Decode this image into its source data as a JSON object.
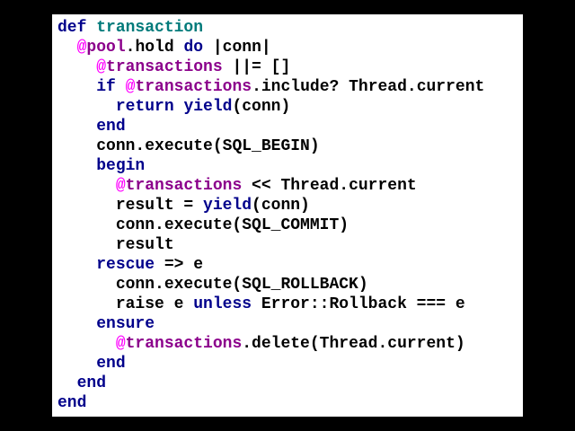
{
  "colors": {
    "background": "#000000",
    "panel": "#ffffff",
    "plain": "#000000",
    "keyword": "#00008b",
    "method_name": "#007a7a",
    "ivar_at": "#ff00ff",
    "ivar_name": "#8b008b"
  },
  "code": {
    "lines": [
      {
        "indent": 0,
        "tokens": [
          {
            "t": "def",
            "k": "keyword"
          },
          {
            "t": " ",
            "k": "plain"
          },
          {
            "t": "transaction",
            "k": "method_name"
          }
        ]
      },
      {
        "indent": 1,
        "tokens": [
          {
            "t": "@",
            "k": "ivar_at"
          },
          {
            "t": "pool",
            "k": "ivar_name"
          },
          {
            "t": ".hold ",
            "k": "plain"
          },
          {
            "t": "do",
            "k": "keyword"
          },
          {
            "t": " |conn|",
            "k": "plain"
          }
        ]
      },
      {
        "indent": 2,
        "tokens": [
          {
            "t": "@",
            "k": "ivar_at"
          },
          {
            "t": "transactions",
            "k": "ivar_name"
          },
          {
            "t": " ||= []",
            "k": "plain"
          }
        ]
      },
      {
        "indent": 2,
        "tokens": [
          {
            "t": "if",
            "k": "keyword"
          },
          {
            "t": " ",
            "k": "plain"
          },
          {
            "t": "@",
            "k": "ivar_at"
          },
          {
            "t": "transactions",
            "k": "ivar_name"
          },
          {
            "t": ".include? Thread.current",
            "k": "plain"
          }
        ]
      },
      {
        "indent": 3,
        "tokens": [
          {
            "t": "return",
            "k": "keyword"
          },
          {
            "t": " ",
            "k": "plain"
          },
          {
            "t": "yield",
            "k": "keyword"
          },
          {
            "t": "(conn)",
            "k": "plain"
          }
        ]
      },
      {
        "indent": 2,
        "tokens": [
          {
            "t": "end",
            "k": "keyword"
          }
        ]
      },
      {
        "indent": 2,
        "tokens": [
          {
            "t": "conn.execute(SQL_BEGIN)",
            "k": "plain"
          }
        ]
      },
      {
        "indent": 2,
        "tokens": [
          {
            "t": "begin",
            "k": "keyword"
          }
        ]
      },
      {
        "indent": 3,
        "tokens": [
          {
            "t": "@",
            "k": "ivar_at"
          },
          {
            "t": "transactions",
            "k": "ivar_name"
          },
          {
            "t": " << Thread.current",
            "k": "plain"
          }
        ]
      },
      {
        "indent": 3,
        "tokens": [
          {
            "t": "result = ",
            "k": "plain"
          },
          {
            "t": "yield",
            "k": "keyword"
          },
          {
            "t": "(conn)",
            "k": "plain"
          }
        ]
      },
      {
        "indent": 3,
        "tokens": [
          {
            "t": "conn.execute(SQL_COMMIT)",
            "k": "plain"
          }
        ]
      },
      {
        "indent": 3,
        "tokens": [
          {
            "t": "result",
            "k": "plain"
          }
        ]
      },
      {
        "indent": 2,
        "tokens": [
          {
            "t": "rescue",
            "k": "keyword"
          },
          {
            "t": " => e",
            "k": "plain"
          }
        ]
      },
      {
        "indent": 3,
        "tokens": [
          {
            "t": "conn.execute(SQL_ROLLBACK)",
            "k": "plain"
          }
        ]
      },
      {
        "indent": 3,
        "tokens": [
          {
            "t": "raise e ",
            "k": "plain"
          },
          {
            "t": "unless",
            "k": "keyword"
          },
          {
            "t": " Error::Rollback === e",
            "k": "plain"
          }
        ]
      },
      {
        "indent": 2,
        "tokens": [
          {
            "t": "ensure",
            "k": "keyword"
          }
        ]
      },
      {
        "indent": 3,
        "tokens": [
          {
            "t": "@",
            "k": "ivar_at"
          },
          {
            "t": "transactions",
            "k": "ivar_name"
          },
          {
            "t": ".delete(Thread.current)",
            "k": "plain"
          }
        ]
      },
      {
        "indent": 2,
        "tokens": [
          {
            "t": "end",
            "k": "keyword"
          }
        ]
      },
      {
        "indent": 1,
        "tokens": [
          {
            "t": "end",
            "k": "keyword"
          }
        ]
      },
      {
        "indent": 0,
        "tokens": [
          {
            "t": "end",
            "k": "keyword"
          }
        ]
      }
    ]
  }
}
